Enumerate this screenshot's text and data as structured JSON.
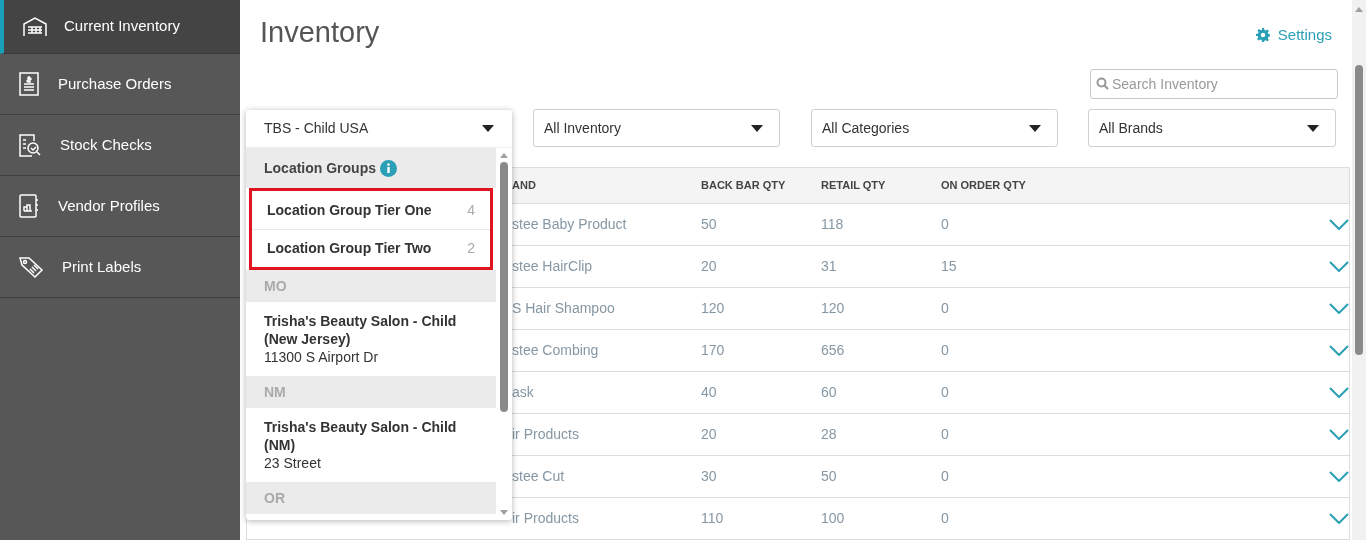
{
  "sidebar": {
    "items": [
      {
        "label": "Current Inventory",
        "selected": true
      },
      {
        "label": "Purchase Orders",
        "selected": false
      },
      {
        "label": "Stock Checks",
        "selected": false
      },
      {
        "label": "Vendor Profiles",
        "selected": false
      },
      {
        "label": "Print Labels",
        "selected": false
      }
    ]
  },
  "title": "Inventory",
  "settings": "Settings",
  "search": {
    "placeholder": "Search Inventory"
  },
  "filters": [
    "All Inventory",
    "All Categories",
    "All Brands"
  ],
  "location_dropdown": {
    "value": "TBS - Child USA",
    "groups_header": "Location Groups",
    "groups": [
      {
        "label": "Location Group Tier One",
        "count": "4"
      },
      {
        "label": "Location Group Tier Two",
        "count": "2"
      }
    ],
    "sections": [
      {
        "heading": "MO",
        "locations": [
          {
            "name": "Trisha's Beauty Salon - Child (New Jersey)",
            "address": "11300 S Airport Dr"
          }
        ]
      },
      {
        "heading": "NM",
        "locations": [
          {
            "name": "Trisha's Beauty Salon - Child (NM)",
            "address": "23 Street"
          }
        ]
      },
      {
        "heading": "OR"
      }
    ]
  },
  "table": {
    "columns": [
      "AND",
      "BACK BAR QTY",
      "RETAIL QTY",
      "ON ORDER QTY"
    ],
    "rows": [
      [
        "stee Baby Product",
        "50",
        "118",
        "0"
      ],
      [
        "stee HairClip",
        "20",
        "31",
        "15"
      ],
      [
        "S Hair Shampoo",
        "120",
        "120",
        "0"
      ],
      [
        "stee Combing",
        "170",
        "656",
        "0"
      ],
      [
        "ask",
        "40",
        "60",
        "0"
      ],
      [
        "ir Products",
        "20",
        "28",
        "0"
      ],
      [
        "stee Cut",
        "30",
        "50",
        "0"
      ],
      [
        "ir Products",
        "110",
        "100",
        "0"
      ]
    ]
  }
}
